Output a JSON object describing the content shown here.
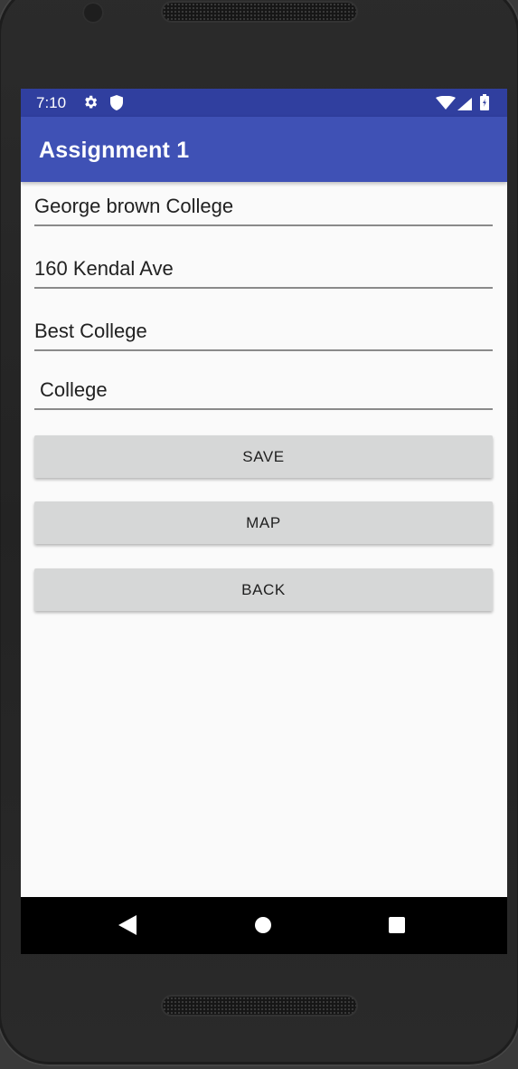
{
  "status_bar": {
    "time": "7:10",
    "icons": [
      "gear-icon",
      "shield-icon",
      "wifi-icon",
      "signal-icon",
      "battery-icon"
    ]
  },
  "app_bar": {
    "title": "Assignment 1",
    "color": "#3f51b5",
    "status_color": "#303f9f"
  },
  "form": {
    "fields": [
      {
        "value": "George brown College"
      },
      {
        "value": "160 Kendal Ave"
      },
      {
        "value": "Best College"
      },
      {
        "value": "College"
      }
    ],
    "buttons": {
      "save": "SAVE",
      "map": "MAP",
      "back": "BACK"
    }
  },
  "nav_bar": {
    "icons": [
      "nav-back-icon",
      "nav-home-icon",
      "nav-recent-apps-icon"
    ]
  }
}
